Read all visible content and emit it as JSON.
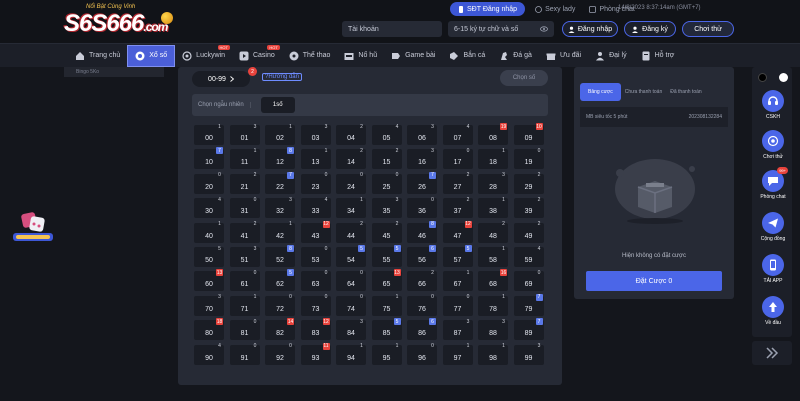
{
  "header": {
    "logo_text": "S6S666",
    "logo_suffix": ".com",
    "logo_tagline": "Nổi Bật Cùng Vinh",
    "top_links": [
      "SĐT Đăng nhập",
      "Sexy lady",
      "Phòng chat"
    ],
    "datetime": "14/8/2023 8:37:14am",
    "timezone": "(GMT+7)",
    "account_placeholder": "Tài khoản",
    "password_placeholder": "6-15 ký tự chữ và số",
    "login_label": "Đăng nhập",
    "register_label": "Đăng ký",
    "demo_label": "Chơi thử"
  },
  "nav": [
    {
      "label": "Trang chủ",
      "hot": false
    },
    {
      "label": "Xổ số",
      "hot": false,
      "active": true
    },
    {
      "label": "Luckywin",
      "hot": true
    },
    {
      "label": "Casino",
      "hot": true
    },
    {
      "label": "Thể thao",
      "hot": false
    },
    {
      "label": "Nổ hũ",
      "hot": false
    },
    {
      "label": "Game bài",
      "hot": false
    },
    {
      "label": "Bắn cá",
      "hot": false
    },
    {
      "label": "Đá gà",
      "hot": false
    },
    {
      "label": "Ưu đãi",
      "hot": false
    },
    {
      "label": "Đại lý",
      "hot": false
    },
    {
      "label": "Hỗ trợ",
      "hot": false
    }
  ],
  "hot_label": "HOT",
  "left_panel_text": "Bingo 5Ko",
  "board": {
    "range": "00-99",
    "range_badge": "2",
    "guide": "Hướng dẫn",
    "choose_label": "Chọn số",
    "random_label": "Chọn ngẫu nhiên",
    "random_option": "1số",
    "cells": [
      {
        "n": "00",
        "c": "1",
        "t": "n"
      },
      {
        "n": "01",
        "c": "3",
        "t": "n"
      },
      {
        "n": "02",
        "c": "1",
        "t": "n"
      },
      {
        "n": "03",
        "c": "3",
        "t": "n"
      },
      {
        "n": "04",
        "c": "2",
        "t": "n"
      },
      {
        "n": "05",
        "c": "4",
        "t": "n"
      },
      {
        "n": "06",
        "c": "3",
        "t": "n"
      },
      {
        "n": "07",
        "c": "4",
        "t": "n"
      },
      {
        "n": "08",
        "c": "19",
        "t": "r"
      },
      {
        "n": "09",
        "c": "10",
        "t": "r"
      },
      {
        "n": "10",
        "c": "7",
        "t": "b"
      },
      {
        "n": "11",
        "c": "1",
        "t": "n"
      },
      {
        "n": "12",
        "c": "8",
        "t": "b"
      },
      {
        "n": "13",
        "c": "1",
        "t": "n"
      },
      {
        "n": "14",
        "c": "2",
        "t": "n"
      },
      {
        "n": "15",
        "c": "2",
        "t": "n"
      },
      {
        "n": "16",
        "c": "3",
        "t": "n"
      },
      {
        "n": "17",
        "c": "0",
        "t": "n"
      },
      {
        "n": "18",
        "c": "1",
        "t": "n"
      },
      {
        "n": "19",
        "c": "0",
        "t": "n"
      },
      {
        "n": "20",
        "c": "0",
        "t": "n"
      },
      {
        "n": "21",
        "c": "2",
        "t": "n"
      },
      {
        "n": "22",
        "c": "7",
        "t": "b"
      },
      {
        "n": "23",
        "c": "0",
        "t": "n"
      },
      {
        "n": "24",
        "c": "0",
        "t": "n"
      },
      {
        "n": "25",
        "c": "0",
        "t": "n"
      },
      {
        "n": "26",
        "c": "7",
        "t": "b"
      },
      {
        "n": "27",
        "c": "2",
        "t": "n"
      },
      {
        "n": "28",
        "c": "3",
        "t": "n"
      },
      {
        "n": "29",
        "c": "2",
        "t": "n"
      },
      {
        "n": "30",
        "c": "4",
        "t": "n"
      },
      {
        "n": "31",
        "c": "0",
        "t": "n"
      },
      {
        "n": "32",
        "c": "3",
        "t": "n"
      },
      {
        "n": "33",
        "c": "4",
        "t": "n"
      },
      {
        "n": "34",
        "c": "1",
        "t": "n"
      },
      {
        "n": "35",
        "c": "3",
        "t": "n"
      },
      {
        "n": "36",
        "c": "0",
        "t": "n"
      },
      {
        "n": "37",
        "c": "2",
        "t": "n"
      },
      {
        "n": "38",
        "c": "1",
        "t": "n"
      },
      {
        "n": "39",
        "c": "2",
        "t": "n"
      },
      {
        "n": "40",
        "c": "1",
        "t": "n"
      },
      {
        "n": "41",
        "c": "2",
        "t": "n"
      },
      {
        "n": "42",
        "c": "1",
        "t": "n"
      },
      {
        "n": "43",
        "c": "12",
        "t": "r"
      },
      {
        "n": "44",
        "c": "2",
        "t": "n"
      },
      {
        "n": "45",
        "c": "2",
        "t": "n"
      },
      {
        "n": "46",
        "c": "8",
        "t": "b"
      },
      {
        "n": "47",
        "c": "12",
        "t": "r"
      },
      {
        "n": "48",
        "c": "2",
        "t": "n"
      },
      {
        "n": "49",
        "c": "2",
        "t": "n"
      },
      {
        "n": "50",
        "c": "5",
        "t": "n"
      },
      {
        "n": "51",
        "c": "3",
        "t": "n"
      },
      {
        "n": "52",
        "c": "8",
        "t": "b"
      },
      {
        "n": "53",
        "c": "0",
        "t": "n"
      },
      {
        "n": "54",
        "c": "5",
        "t": "b"
      },
      {
        "n": "55",
        "c": "5",
        "t": "b"
      },
      {
        "n": "56",
        "c": "6",
        "t": "b"
      },
      {
        "n": "57",
        "c": "5",
        "t": "b"
      },
      {
        "n": "58",
        "c": "1",
        "t": "n"
      },
      {
        "n": "59",
        "c": "4",
        "t": "n"
      },
      {
        "n": "60",
        "c": "13",
        "t": "r"
      },
      {
        "n": "61",
        "c": "0",
        "t": "n"
      },
      {
        "n": "62",
        "c": "5",
        "t": "b"
      },
      {
        "n": "63",
        "c": "0",
        "t": "n"
      },
      {
        "n": "64",
        "c": "0",
        "t": "n"
      },
      {
        "n": "65",
        "c": "13",
        "t": "r"
      },
      {
        "n": "66",
        "c": "2",
        "t": "n"
      },
      {
        "n": "67",
        "c": "1",
        "t": "n"
      },
      {
        "n": "68",
        "c": "16",
        "t": "r"
      },
      {
        "n": "69",
        "c": "0",
        "t": "n"
      },
      {
        "n": "70",
        "c": "3",
        "t": "n"
      },
      {
        "n": "71",
        "c": "1",
        "t": "n"
      },
      {
        "n": "72",
        "c": "0",
        "t": "n"
      },
      {
        "n": "73",
        "c": "0",
        "t": "n"
      },
      {
        "n": "74",
        "c": "0",
        "t": "n"
      },
      {
        "n": "75",
        "c": "1",
        "t": "n"
      },
      {
        "n": "76",
        "c": "0",
        "t": "n"
      },
      {
        "n": "77",
        "c": "0",
        "t": "n"
      },
      {
        "n": "78",
        "c": "1",
        "t": "n"
      },
      {
        "n": "79",
        "c": "7",
        "t": "b"
      },
      {
        "n": "80",
        "c": "18",
        "t": "r"
      },
      {
        "n": "81",
        "c": "0",
        "t": "n"
      },
      {
        "n": "82",
        "c": "14",
        "t": "r"
      },
      {
        "n": "83",
        "c": "12",
        "t": "r"
      },
      {
        "n": "84",
        "c": "3",
        "t": "n"
      },
      {
        "n": "85",
        "c": "5",
        "t": "b"
      },
      {
        "n": "86",
        "c": "6",
        "t": "b"
      },
      {
        "n": "87",
        "c": "3",
        "t": "n"
      },
      {
        "n": "88",
        "c": "3",
        "t": "n"
      },
      {
        "n": "89",
        "c": "7",
        "t": "b"
      },
      {
        "n": "90",
        "c": "4",
        "t": "n"
      },
      {
        "n": "91",
        "c": "0",
        "t": "n"
      },
      {
        "n": "92",
        "c": "0",
        "t": "n"
      },
      {
        "n": "93",
        "c": "11",
        "t": "r"
      },
      {
        "n": "94",
        "c": "1",
        "t": "n"
      },
      {
        "n": "95",
        "c": "1",
        "t": "n"
      },
      {
        "n": "96",
        "c": "0",
        "t": "n"
      },
      {
        "n": "97",
        "c": "1",
        "t": "n"
      },
      {
        "n": "98",
        "c": "1",
        "t": "n"
      },
      {
        "n": "99",
        "c": "3",
        "t": "n"
      }
    ]
  },
  "bet_panel": {
    "tabs": [
      "Bảng cược",
      "Chưa thanh toán",
      "Đã thanh toán"
    ],
    "game_name": "MB siêu tốc 5 phút",
    "round_id": "202308132284",
    "empty_text": "Hiện không có đặt cược",
    "bet_button": "Đặt Cược 0"
  },
  "right_bar": {
    "items": [
      {
        "label": "CSKH",
        "icon": "headset-icon"
      },
      {
        "label": "Chơi thử",
        "icon": "gamepad-icon"
      },
      {
        "label": "Phòng chat",
        "icon": "chat-icon",
        "badge": "99+"
      },
      {
        "label": "Cộng đồng",
        "icon": "telegram-icon"
      },
      {
        "label": "TẢI APP",
        "icon": "phone-icon"
      },
      {
        "label": "Về đầu",
        "icon": "arrow-up-icon"
      }
    ]
  },
  "colors": {
    "accent": "#4b66e8",
    "background": "#14161c",
    "panel": "#262a35",
    "hot": "#e8433c"
  }
}
